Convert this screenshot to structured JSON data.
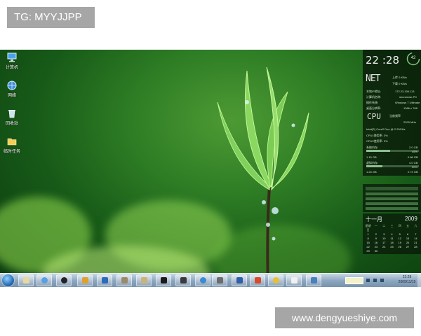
{
  "watermarks": {
    "top": "TG: MYYJJPP",
    "bottom": "www.dengyueshiye.com"
  },
  "desktop_icons": [
    {
      "label": "计算机",
      "icon": "computer-icon"
    },
    {
      "label": "网络",
      "icon": "network-icon"
    },
    {
      "label": "回收站",
      "icon": "recycle-bin-icon"
    },
    {
      "label": "临时任务",
      "icon": "folder-icon"
    }
  ],
  "clock_gadget": {
    "time": "22 :28",
    "seconds": "42"
  },
  "network_gadget": {
    "logo": "NET",
    "upload": "上传 0 KB/s",
    "download": "下载 0 KB/s",
    "rows": [
      {
        "label": "本地IP地址:",
        "value": "172.23.106.113"
      },
      {
        "label": "计算机名称:",
        "value": "shunmcse-PC"
      },
      {
        "label": "操作系统:",
        "value": "Windows 7 Ultimate"
      },
      {
        "label": "桌面分辨率:",
        "value": "1366 x 768"
      }
    ]
  },
  "cpu_gadget": {
    "logo": "CPU",
    "label": "当前频率",
    "freq": "2200 MHz",
    "model": "Intel(R) Core2 Duo @ 2.20GHz",
    "core1": "CPU1使用率: 3%",
    "core2": "CPU2使用率: 3%",
    "mem_label": "系统内存:",
    "mem_total": "2.0 GB",
    "mem_percent": "45%",
    "mem_used": "1.15 GB",
    "mem_free": "0.86 GB",
    "vmem_label": "虚拟内存:",
    "vmem_total": "4.0 GB",
    "vmem_percent": "30%",
    "vmem_used": "1.24 GB",
    "vmem_free": "2.73 GB"
  },
  "calendar": {
    "month": "十一月",
    "year": "2009",
    "weekdays": [
      "星期日",
      "一",
      "二",
      "三",
      "四",
      "五",
      "六"
    ],
    "days": [
      "1",
      "2",
      "3",
      "4",
      "5",
      "6",
      "7",
      "8",
      "9",
      "10",
      "11",
      "12",
      "13",
      "14",
      "15",
      "16",
      "17",
      "18",
      "19",
      "20",
      "21",
      "22",
      "23",
      "24",
      "25",
      "26",
      "27",
      "28",
      "29",
      "30"
    ]
  },
  "taskbar": {
    "time": "22:28",
    "date": "2009/11/19"
  },
  "colors": {
    "taskbar": "#8aa5bf",
    "gadget_bg": "#081608",
    "accent_green": "#8fbf8f"
  }
}
